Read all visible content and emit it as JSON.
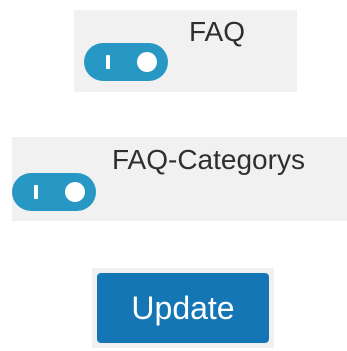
{
  "settings": {
    "faq": {
      "label": "FAQ",
      "enabled": true
    },
    "faq_categories": {
      "label": "FAQ-Categorys",
      "enabled": true
    }
  },
  "actions": {
    "update_label": "Update"
  },
  "colors": {
    "toggle_on": "#2797c4",
    "button_primary": "#1576b5",
    "row_background": "#f1f1f1"
  }
}
